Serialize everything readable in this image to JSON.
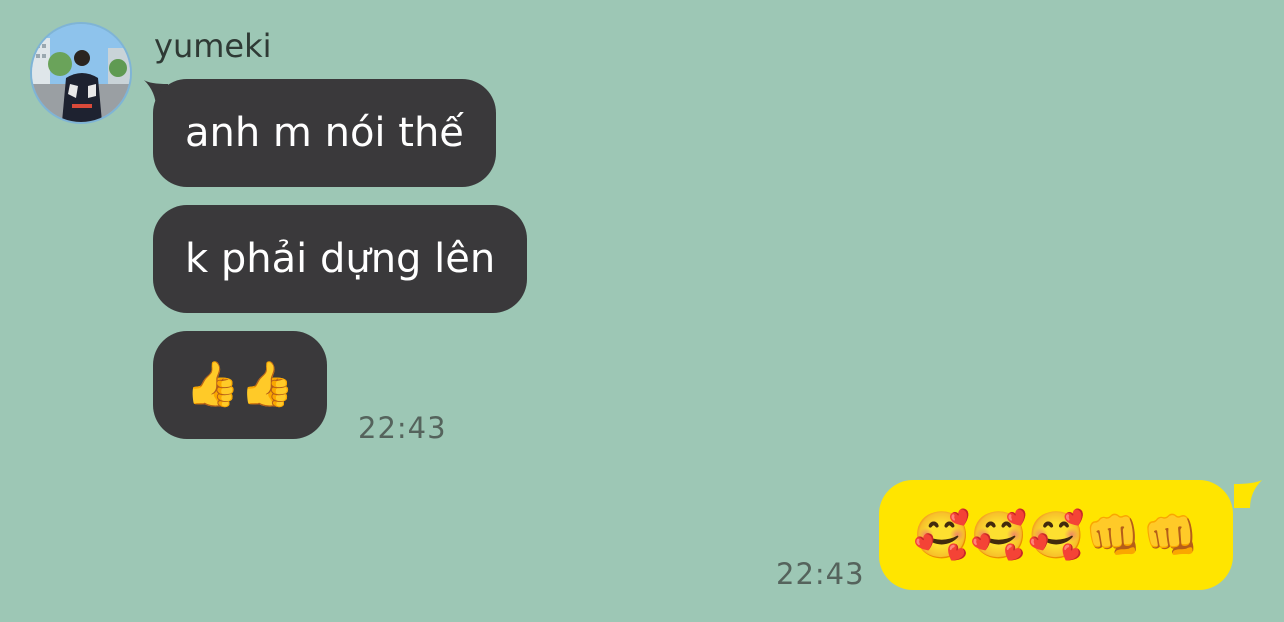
{
  "chat": {
    "contact": {
      "name": "yumeki",
      "avatar_icon": "profile-photo"
    },
    "incoming": [
      {
        "text": "anh m nói thế"
      },
      {
        "text": "k phải dựng lên"
      },
      {
        "text": "👍👍"
      }
    ],
    "incoming_time": "22:43",
    "outgoing": [
      {
        "text": "🥰🥰🥰👊👊"
      }
    ],
    "outgoing_time": "22:43"
  },
  "colors": {
    "background": "#9dc7b5",
    "incoming_bubble": "#3a393b",
    "outgoing_bubble": "#ffe500"
  }
}
